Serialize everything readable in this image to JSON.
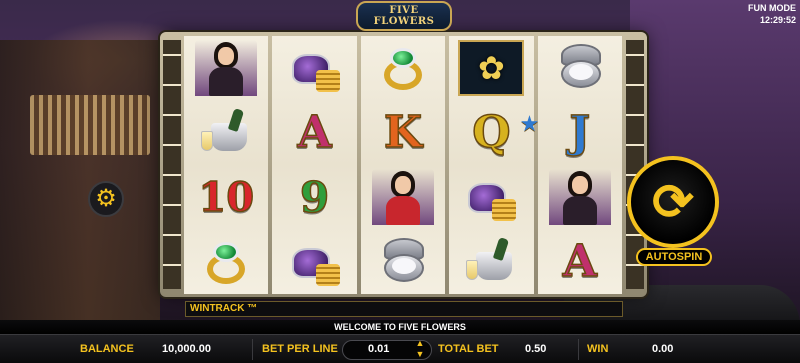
{
  "game": {
    "logo_line1": "FIVE",
    "logo_line2": "FLOWERS",
    "mode": "FUN MODE",
    "clock": "12:29:52"
  },
  "reels": [
    [
      "lady-dark",
      "purse-coins",
      "jade-ring",
      "flower-tile"
    ],
    [
      "champagne-bucket",
      "A",
      "K",
      "Q"
    ],
    [
      "10",
      "9",
      "lady-red",
      "purse-coins"
    ],
    [
      "jade-ring",
      "purse-coins",
      "silver-compact",
      "champagne-bucket"
    ]
  ],
  "reel_columns": [
    {
      "cells": [
        "lady-dark",
        "champagne-bucket",
        "10",
        "jade-ring"
      ]
    },
    {
      "cells": [
        "purse-coins",
        "A",
        "9",
        "purse-coins"
      ]
    },
    {
      "cells": [
        "jade-ring",
        "K",
        "lady-red",
        "silver-compact"
      ]
    },
    {
      "cells": [
        "flower-tile",
        "Q",
        "purse-coins",
        "champagne-bucket"
      ]
    },
    {
      "cells": [
        "silver-compact",
        "J",
        "lady-dark",
        "A"
      ]
    }
  ],
  "labels": {
    "wintrack": "WINTRACK ™",
    "message": "WELCOME TO FIVE FLOWERS",
    "autospin": "AUTOSPIN"
  },
  "hud": {
    "balance_label": "BALANCE",
    "balance_value": "10,000.00",
    "bet_per_line_label": "BET PER LINE",
    "bet_per_line_value": "0.01",
    "total_bet_label": "TOTAL BET",
    "total_bet_value": "0.50",
    "win_label": "WIN",
    "win_value": "0.00"
  },
  "icons": {
    "settings": "gear-icon",
    "autospin": "autospin-arrows-icon",
    "bet_up": "triangle-up-icon",
    "bet_down": "triangle-down-icon"
  },
  "colors": {
    "accent": "#f4c21f",
    "hud_bg": "#0a0a0b",
    "reel_bg": "#f4efe1"
  }
}
